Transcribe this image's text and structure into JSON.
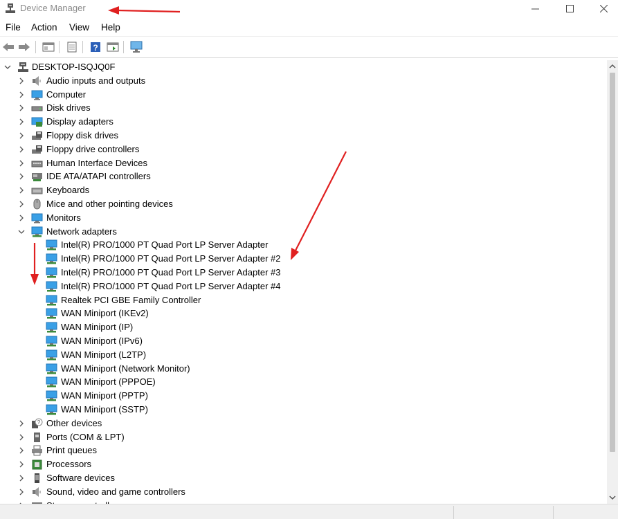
{
  "window": {
    "title": "Device Manager",
    "controls": {
      "minimize": "minimize",
      "maximize": "maximize",
      "close": "close"
    }
  },
  "menu": [
    "File",
    "Action",
    "View",
    "Help"
  ],
  "toolbar": [
    "back-arrow-icon",
    "forward-arrow-icon",
    "show-hide-console-tree-icon",
    "properties-icon",
    "help-icon",
    "update-driver-icon",
    "scan-hardware-icon"
  ],
  "tree": {
    "root": "DESKTOP-ISQJQ0F",
    "categories": [
      {
        "label": "Audio inputs and outputs",
        "icon": "speaker-icon",
        "expanded": false
      },
      {
        "label": "Computer",
        "icon": "computer-icon",
        "expanded": false
      },
      {
        "label": "Disk drives",
        "icon": "disk-drive-icon",
        "expanded": false
      },
      {
        "label": "Display adapters",
        "icon": "display-adapter-icon",
        "expanded": false
      },
      {
        "label": "Floppy disk drives",
        "icon": "floppy-drive-icon",
        "expanded": false
      },
      {
        "label": "Floppy drive controllers",
        "icon": "floppy-controller-icon",
        "expanded": false
      },
      {
        "label": "Human Interface Devices",
        "icon": "hid-icon",
        "expanded": false
      },
      {
        "label": "IDE ATA/ATAPI controllers",
        "icon": "ide-controller-icon",
        "expanded": false
      },
      {
        "label": "Keyboards",
        "icon": "keyboard-icon",
        "expanded": false
      },
      {
        "label": "Mice and other pointing devices",
        "icon": "mouse-icon",
        "expanded": false
      },
      {
        "label": "Monitors",
        "icon": "monitor-icon",
        "expanded": false
      },
      {
        "label": "Network adapters",
        "icon": "network-adapter-icon",
        "expanded": true,
        "children": [
          "Intel(R) PRO/1000 PT Quad Port LP Server Adapter",
          "Intel(R) PRO/1000 PT Quad Port LP Server Adapter #2",
          "Intel(R) PRO/1000 PT Quad Port LP Server Adapter #3",
          "Intel(R) PRO/1000 PT Quad Port LP Server Adapter #4",
          "Realtek PCI GBE Family Controller",
          "WAN Miniport (IKEv2)",
          "WAN Miniport (IP)",
          "WAN Miniport (IPv6)",
          "WAN Miniport (L2TP)",
          "WAN Miniport (Network Monitor)",
          "WAN Miniport (PPPOE)",
          "WAN Miniport (PPTP)",
          "WAN Miniport (SSTP)"
        ]
      },
      {
        "label": "Other devices",
        "icon": "unknown-device-icon",
        "expanded": false
      },
      {
        "label": "Ports (COM & LPT)",
        "icon": "port-icon",
        "expanded": false
      },
      {
        "label": "Print queues",
        "icon": "printer-icon",
        "expanded": false
      },
      {
        "label": "Processors",
        "icon": "processor-icon",
        "expanded": false
      },
      {
        "label": "Software devices",
        "icon": "software-device-icon",
        "expanded": false
      },
      {
        "label": "Sound, video and game controllers",
        "icon": "speaker-icon",
        "expanded": false
      },
      {
        "label": "Storage controllers",
        "icon": "storage-controller-icon",
        "expanded": false
      }
    ]
  },
  "colors": {
    "annotation_arrow": "#e02020",
    "icon_blue": "#2d8fd6",
    "selection": "#cce8ff"
  }
}
